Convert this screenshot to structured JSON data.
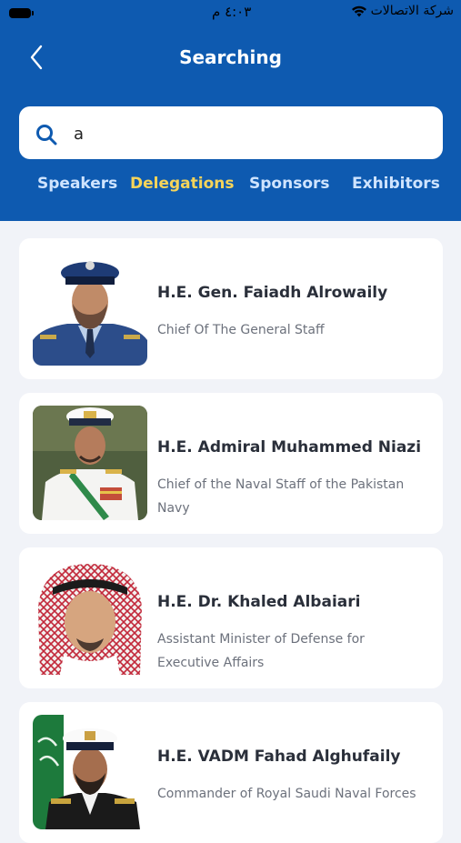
{
  "status_bar": {
    "time": "٤:٠٣ م",
    "carrier": "شركة الاتصالات"
  },
  "header": {
    "title": "Searching"
  },
  "search": {
    "value": "a",
    "placeholder": ""
  },
  "tabs": [
    {
      "label": "Speakers",
      "active": false
    },
    {
      "label": "Delegations",
      "active": true
    },
    {
      "label": "Sponsors",
      "active": false
    },
    {
      "label": "Exhibitors",
      "active": false
    }
  ],
  "results": [
    {
      "name": "H.E. Gen. Faiadh Alrowaily",
      "role": "Chief Of The General Staff"
    },
    {
      "name": "H.E. Admiral Muhammed Niazi",
      "role": "Chief of the Naval Staff of the Pakistan Navy"
    },
    {
      "name": "H.E. Dr. Khaled Albaiari",
      "role": "Assistant Minister of Defense for Executive Affairs"
    },
    {
      "name": "H.E. VADM Fahad Alghufaily",
      "role": "Commander of Royal Saudi Naval Forces"
    }
  ],
  "colors": {
    "header_bg": "#0e5ab0",
    "active_tab": "#f5d45a",
    "inactive_tab": "#cfe4ff",
    "page_bg": "#f1f3f8"
  }
}
